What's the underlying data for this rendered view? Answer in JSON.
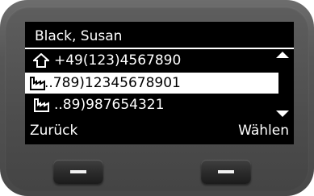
{
  "screen": {
    "title": "Black, Susan",
    "entries": [
      {
        "icon": "home-icon",
        "number": "+49(123)4567890",
        "selected": false
      },
      {
        "icon": "office-icon",
        "number": "..789)12345678901",
        "selected": true
      },
      {
        "icon": "office-icon",
        "number": "..89)987654321",
        "selected": false
      }
    ],
    "softkeys": {
      "left": "Zurück",
      "right": "Wählen"
    }
  }
}
